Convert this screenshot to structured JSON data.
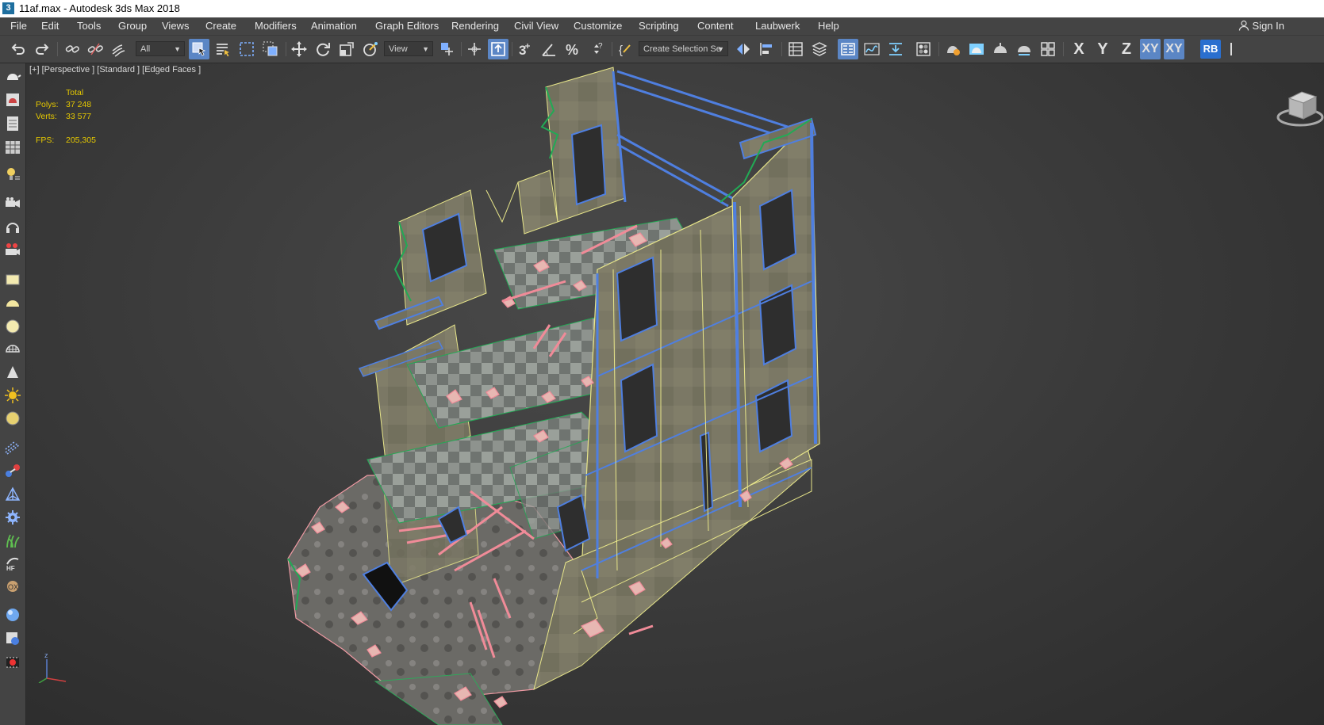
{
  "window": {
    "title": "11af.max - Autodesk 3ds Max 2018",
    "app_icon": "3"
  },
  "menu": [
    "File",
    "Edit",
    "Tools",
    "Group",
    "Views",
    "Create",
    "Modifiers",
    "Animation",
    "Graph Editors",
    "Rendering",
    "Civil View",
    "Customize",
    "Scripting",
    "Content",
    "Laubwerk",
    "Help"
  ],
  "signin": "Sign In",
  "toolbar": {
    "filter_value": "All",
    "coord_value": "View",
    "selection_set_value": "Create Selection Se",
    "axis_x": "X",
    "axis_y": "Y",
    "axis_z": "Z",
    "axis_xy": "XY",
    "axis_xy2": "XY",
    "rb": "RB"
  },
  "viewport": {
    "label": "[+] [Perspective ] [Standard ] [Edged Faces ]",
    "stats": {
      "header": "Total",
      "polys_label": "Polys:",
      "polys_value": "37 248",
      "verts_label": "Verts:",
      "verts_value": "33 577",
      "fps_label": "FPS:",
      "fps_value": "205,305"
    },
    "axis_label_z": "z"
  },
  "colors": {
    "stats": "#e5c800",
    "accent_blue": "#5b86c5",
    "wire_yellow": "#e8e68a",
    "wire_blue": "#4f7fe0",
    "wire_green": "#22aa55",
    "wire_pink": "#f2a0a8"
  }
}
